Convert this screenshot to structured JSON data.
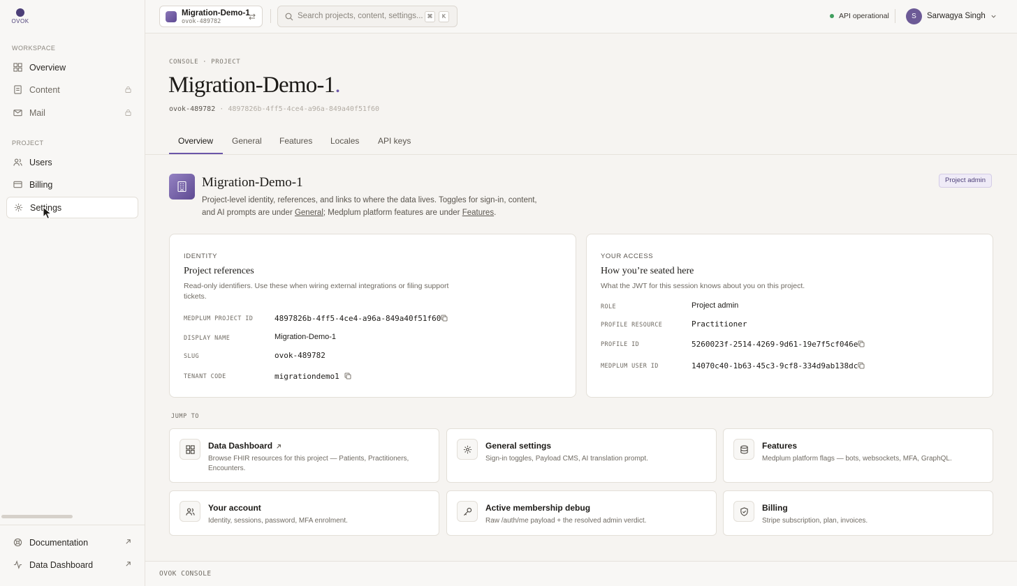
{
  "app": {
    "logo_text": "OVOK"
  },
  "sidebar": {
    "workspace_label": "WORKSPACE",
    "project_label": "PROJECT",
    "items": [
      {
        "label": "Overview",
        "icon": "grid-icon",
        "locked": false
      },
      {
        "label": "Content",
        "icon": "document-icon",
        "locked": true
      },
      {
        "label": "Mail",
        "icon": "mail-icon",
        "locked": true
      },
      {
        "label": "Users",
        "icon": "users-icon",
        "locked": false
      },
      {
        "label": "Billing",
        "icon": "credit-card-icon",
        "locked": false
      },
      {
        "label": "Settings",
        "icon": "gear-icon",
        "locked": false,
        "active": true
      }
    ],
    "bottom": [
      {
        "label": "Documentation",
        "icon": "help-icon"
      },
      {
        "label": "Data Dashboard",
        "icon": "activity-icon"
      }
    ]
  },
  "header": {
    "project_name": "Migration-Demo-1",
    "project_slug": "ovok-489782",
    "search_placeholder": "Search projects, content, settings...",
    "shortcut": [
      "⌘",
      "K"
    ],
    "status": "API operational",
    "user_initial": "S",
    "user_name": "Sarwagya Singh"
  },
  "page": {
    "breadcrumb": "CONSOLE · PROJECT",
    "title": "Migration-Demo-1",
    "title_dot": ".",
    "slug": "ovok-489782",
    "separator": "·",
    "project_uuid": "4897826b-4ff5-4ce4-a96a-849a40f51f60",
    "tabs": [
      "Overview",
      "General",
      "Features",
      "Locales",
      "API keys"
    ],
    "active_tab": "Overview"
  },
  "intro": {
    "title": "Migration-Demo-1",
    "desc_part1": "Project-level identity, references, and links to where the data lives. Toggles for sign-in, content, and AI prompts are under ",
    "desc_link1": "General",
    "desc_part2": "; Medplum platform features are under ",
    "desc_link2": "Features",
    "desc_part3": ".",
    "badge": "Project admin"
  },
  "identity": {
    "eyebrow": "IDENTITY",
    "title": "Project references",
    "desc": "Read-only identifiers. Use these when wiring external integrations or filing support tickets.",
    "rows": [
      {
        "label": "MEDPLUM PROJECT ID",
        "value": "4897826b-4ff5-4ce4-a96a-849a40f51f60",
        "mono": true,
        "copy": true
      },
      {
        "label": "DISPLAY NAME",
        "value": "Migration-Demo-1",
        "mono": false,
        "copy": false
      },
      {
        "label": "SLUG",
        "value": "ovok-489782",
        "mono": true,
        "copy": false
      },
      {
        "label": "TENANT CODE",
        "value": "migrationdemo1",
        "mono": true,
        "copy": true
      }
    ]
  },
  "access": {
    "eyebrow": "YOUR ACCESS",
    "title": "How you’re seated here",
    "desc": "What the JWT for this session knows about you on this project.",
    "rows": [
      {
        "label": "ROLE",
        "value": "Project admin",
        "mono": false,
        "copy": false
      },
      {
        "label": "PROFILE RESOURCE",
        "value": "Practitioner",
        "mono": true,
        "copy": false
      },
      {
        "label": "PROFILE ID",
        "value": "5260023f-2514-4269-9d61-19e7f5cf046e",
        "mono": true,
        "copy": true
      },
      {
        "label": "MEDPLUM USER ID",
        "value": "14070c40-1b63-45c3-9cf8-334d9ab138dc",
        "mono": true,
        "copy": true
      }
    ]
  },
  "jump": {
    "label": "JUMP TO",
    "cards": [
      {
        "title": "Data Dashboard",
        "desc": "Browse FHIR resources for this project — Patients, Practitioners, Encounters.",
        "icon": "grid-icon",
        "external": true
      },
      {
        "title": "General settings",
        "desc": "Sign-in toggles, Payload CMS, AI translation prompt.",
        "icon": "gear-icon",
        "external": false
      },
      {
        "title": "Features",
        "desc": "Medplum platform flags — bots, websockets, MFA, GraphQL.",
        "icon": "database-icon",
        "external": false
      },
      {
        "title": "Your account",
        "desc": "Identity, sessions, password, MFA enrolment.",
        "icon": "users-icon",
        "external": false
      },
      {
        "title": "Active membership debug",
        "desc": "Raw /auth/me payload + the resolved admin verdict.",
        "icon": "key-icon",
        "external": false
      },
      {
        "title": "Billing",
        "desc": "Stripe subscription, plan, invoices.",
        "icon": "shield-check-icon",
        "external": false
      }
    ]
  },
  "footer": {
    "text": "OVOK CONSOLE"
  },
  "colors": {
    "accent": "#6b56a8",
    "status_ok": "#3f9e5d",
    "background": "#f6f4f1"
  }
}
